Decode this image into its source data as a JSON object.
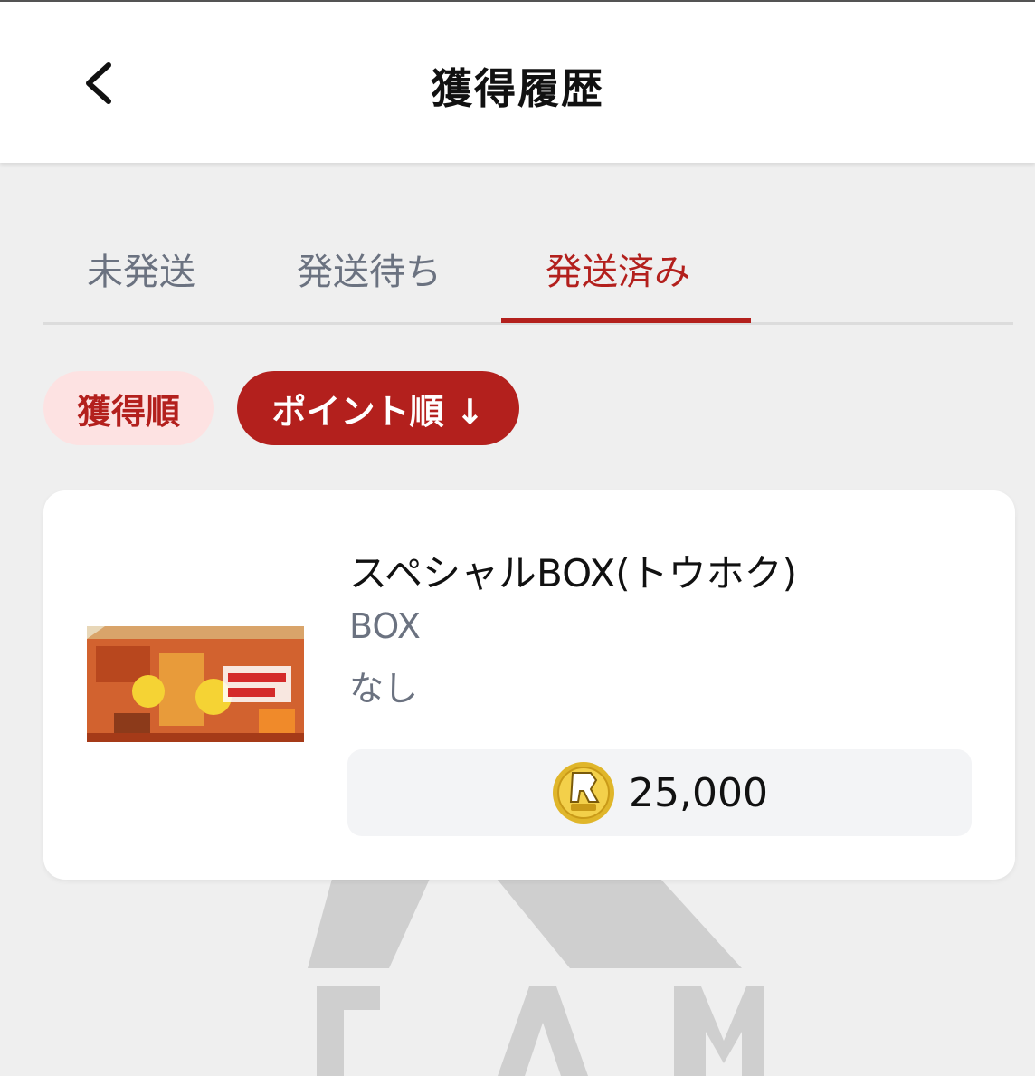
{
  "header": {
    "title": "獲得履歴",
    "back_icon": "chevron-left-icon"
  },
  "tabs": [
    {
      "label": "未発送",
      "active": false
    },
    {
      "label": "発送待ち",
      "active": false
    },
    {
      "label": "発送済み",
      "active": true
    }
  ],
  "sort": {
    "acquired_label": "獲得順",
    "points_label": "ポイント順 ↓"
  },
  "items": [
    {
      "name": "スペシャルBOX(トウホク)",
      "category": "BOX",
      "note": "なし",
      "points": "25,000",
      "coin_icon": "ram-coin-icon",
      "image_icon": "product-box-image"
    }
  ],
  "colors": {
    "accent": "#b3201d",
    "accent_light": "#fde2e2",
    "muted_text": "#6b7280",
    "background": "#efefef"
  }
}
